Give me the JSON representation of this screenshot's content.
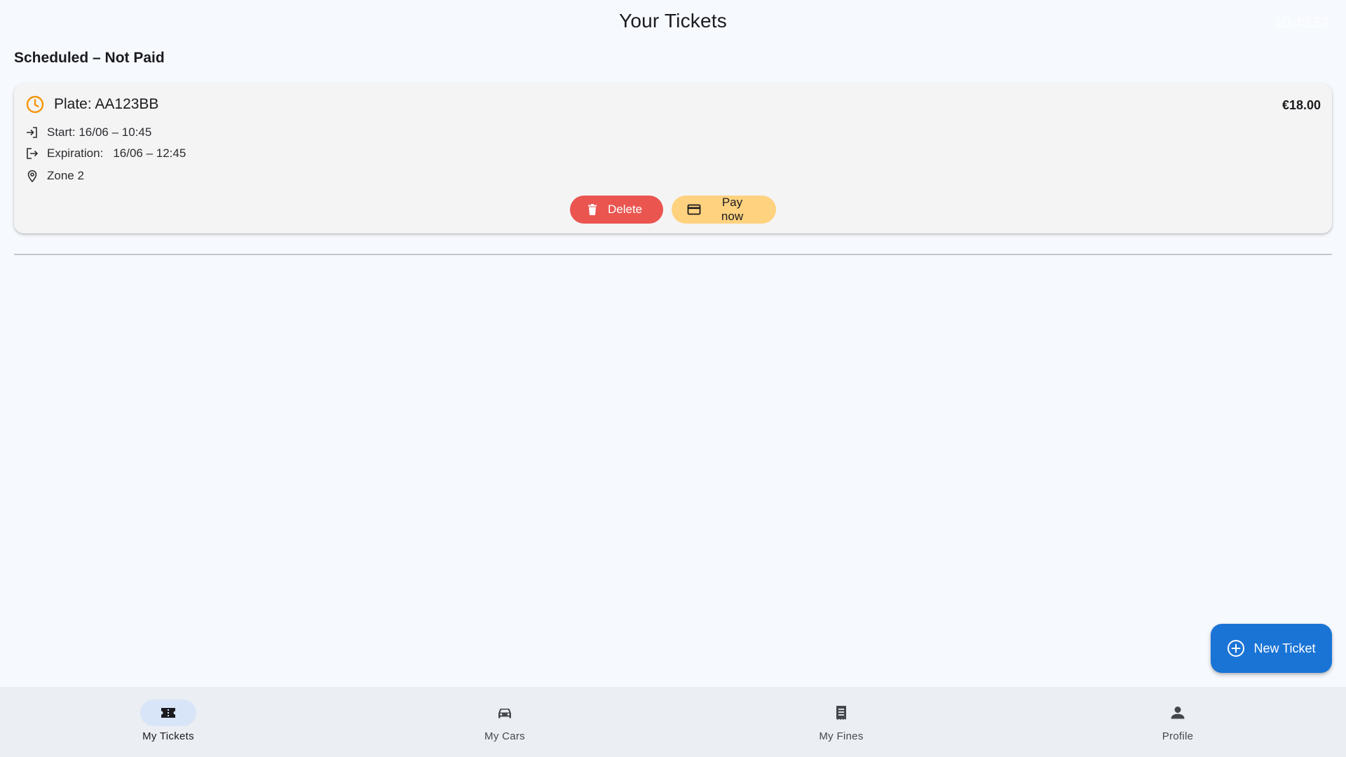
{
  "header": {
    "title": "Your Tickets",
    "clock": "10:43:53"
  },
  "section": {
    "title": "Scheduled – Not Paid"
  },
  "ticket": {
    "plate_label": "Plate: AA123BB",
    "price": "€18.00",
    "start": "Start: 16/06 – 10:45",
    "expiration_label": "Expiration:",
    "expiration_value": "16/06 – 12:45",
    "zone": "Zone 2",
    "status_icon": "clock-icon",
    "status_color": "#f5960a",
    "delete_label": "Delete",
    "delete_color": "#ea5550",
    "pay_label": "Pay now",
    "pay_color": "#ffd27f"
  },
  "fab": {
    "label": "New Ticket",
    "icon": "add-circle-icon",
    "color": "#1a74d6"
  },
  "bottom_nav": {
    "items": [
      {
        "label": "My Tickets",
        "icon": "ticket-icon",
        "active": true
      },
      {
        "label": "My Cars",
        "icon": "car-icon",
        "active": false
      },
      {
        "label": "My Fines",
        "icon": "receipt-icon",
        "active": false
      },
      {
        "label": "Profile",
        "icon": "person-icon",
        "active": false
      }
    ]
  }
}
